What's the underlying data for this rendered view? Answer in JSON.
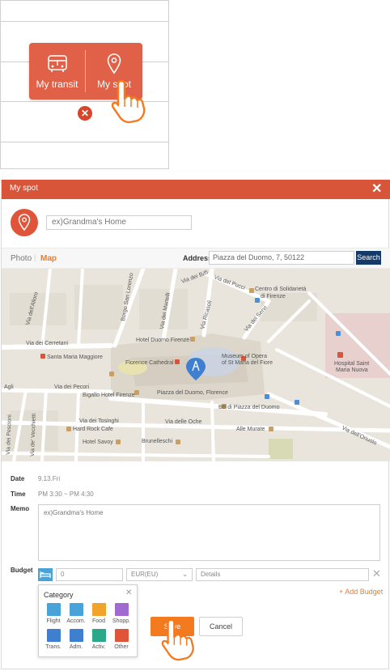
{
  "demo": {
    "transit_label": "My transit",
    "spot_label": "My spot"
  },
  "dialog": {
    "title": "My spot",
    "name_placeholder": "ex)Grandma's Home",
    "tabs": {
      "photo": "Photo",
      "map": "Map"
    },
    "address_label": "Address",
    "address_value": "Piazza del Duomo, 7, 50122",
    "search_label": "Search",
    "map_labels": {
      "via_del_pucci": "Via del Pucci",
      "via_dei_biffi": "Via dei Biffi",
      "via_dei_martelli": "Via dei Martelli",
      "via_ricasoli": "Via Ricasoli",
      "borgo_san_lorenzo": "Borgo San Lorenzo",
      "via_dell_alloro": "Via dell'Alloro",
      "via_dei_servi": "Via dei Servi",
      "centro": "Centro di Solidarietà",
      "di_firenze": "di Firenze",
      "via_dei_cerretani": "Via dei Cerretani",
      "hotel_duomo": "Hotel Duomo Firenze",
      "santa_maria": "Santa Maria Maggiore",
      "florence_cathedral": "Florence Cathedral",
      "museum1": "Museum of Opera",
      "museum2": "of St Maria del Fiore",
      "hospital1": "Hospital Saint",
      "hospital2": "Maria Nuova",
      "agli": "Agli",
      "via_dei_pecori": "Via dei Pecori",
      "bigallo": "Bigallo Hotel Firenze",
      "piazza": "Piazza del Duomo, Florence",
      "bb": "BB di Piazza del Duomo",
      "via_dei_pescioni": "Via dei Pescioni",
      "via_de_vecchietti": "Via de' Vecchietti",
      "via_dei_tosinghi": "Via dei Tosinghi",
      "via_delle_oche": "Via delle Oche",
      "via_dell_oriuolo": "Via dell'Oriuolo",
      "hard_rock": "Hard Rock Cafe",
      "alle_murate": "Alle Murate",
      "hotel_savoy": "Hotel Savoy",
      "brunelleschi": "Brunelleschi"
    },
    "date_label": "Date",
    "date_value": "9.13.Fri",
    "time_label": "Time",
    "time_value": "PM 3:30 ~ PM 4:30",
    "memo_label": "Memo",
    "memo_placeholder": "ex)Grandma's Home",
    "budget_label": "Budget",
    "budget_amount": "0",
    "currency": "EUR(EU)",
    "details_placeholder": "Details",
    "add_budget": "+ Add Budget",
    "save_label": "Save",
    "cancel_label": "Cancel"
  },
  "category": {
    "title": "Category",
    "items": [
      {
        "label": "Flight",
        "color": "#4aa3d8",
        "icon": "flight-icon"
      },
      {
        "label": "Accom.",
        "color": "#4aa3d8",
        "icon": "bed-icon"
      },
      {
        "label": "Food",
        "color": "#f2a32a",
        "icon": "food-icon"
      },
      {
        "label": "Shopp.",
        "color": "#a06ad0",
        "icon": "shopping-icon"
      },
      {
        "label": "Trans.",
        "color": "#3f7fd0",
        "icon": "bus-icon"
      },
      {
        "label": "Adm.",
        "color": "#3f7fd0",
        "icon": "ticket-icon"
      },
      {
        "label": "Activ.",
        "color": "#2aa88a",
        "icon": "activity-icon"
      },
      {
        "label": "Other",
        "color": "#e0553a",
        "icon": "pin-icon"
      }
    ]
  },
  "colors": {
    "header": "#d9553a",
    "accent_orange": "#f47a20",
    "search_button": "#143a6a",
    "map_marker": "#3f7fd0"
  }
}
